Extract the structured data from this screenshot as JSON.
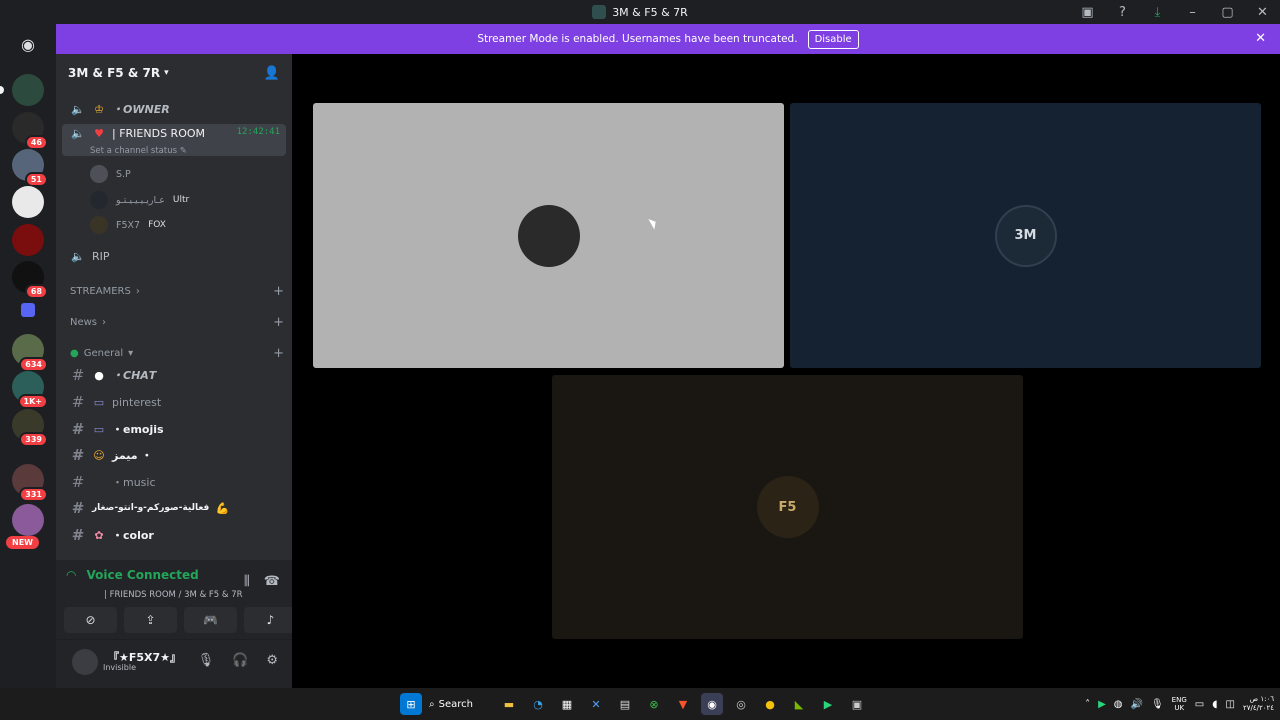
{
  "window": {
    "title": "3M & F5 & 7R"
  },
  "banner": {
    "text": "Streamer Mode is enabled. Usernames have been truncated.",
    "disable_label": "Disable"
  },
  "server": {
    "name": "3M & F5 & 7R"
  },
  "guild_badges": [
    "46",
    "51",
    "68",
    "634",
    "1K+",
    "339",
    "331",
    "NEW"
  ],
  "channels": {
    "owner": "・𝙊𝙒𝙉𝙀𝙍",
    "friends_room": "| FRIENDS ROOM",
    "friends_room_time": "12:42:41",
    "friends_room_status": "Set a channel status",
    "rip": "RIP",
    "cat_streamers": "STREAMERS",
    "cat_news": "News",
    "cat_general": "General",
    "chat": "・𝘾𝙃𝘼𝙏",
    "pinterest": "pinterest",
    "emojis": "・emojis",
    "memes": "ميمز ・",
    "music": "・music",
    "event": "فعالية-صوركم-و-انتو-صغار",
    "color": "・color"
  },
  "voice_users": [
    {
      "name": "S.P",
      "tag": ""
    },
    {
      "name": "عـاريـيـيـيـتـو",
      "tag": "Ultr"
    },
    {
      "name": "F5X7",
      "tag": "FOX"
    }
  ],
  "voice": {
    "status": "Voice Connected",
    "location": "| FRIENDS ROOM / 3M & F5 & 7R"
  },
  "user": {
    "name": "『★F5X7★』",
    "status": "Invisible"
  },
  "tiles": [
    {
      "label": "",
      "bg": "#b2b2b2"
    },
    {
      "label": "3M",
      "bg": "#142231"
    },
    {
      "label": "F5",
      "bg": "#1a1712"
    }
  ],
  "taskbar": {
    "search_label": "Search",
    "lang_top": "ENG",
    "lang_bottom": "UK",
    "time": "١:٠٦ ص",
    "date": "٢٧/٤/٢٠٢٤"
  }
}
